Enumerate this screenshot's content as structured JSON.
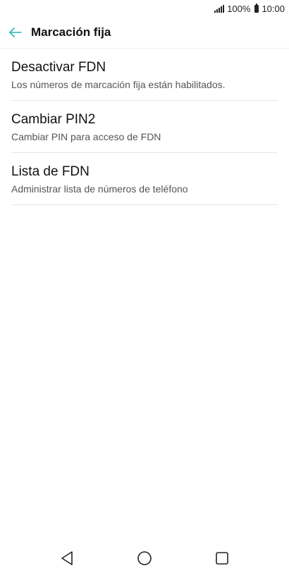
{
  "status_bar": {
    "battery_percent": "100%",
    "time": "10:00",
    "icons": [
      "signal-icon",
      "battery-icon"
    ]
  },
  "app_bar": {
    "title": "Marcación fija",
    "back_icon": "arrow-left-icon",
    "accent_color": "#2ab5b5"
  },
  "items": [
    {
      "title": "Desactivar FDN",
      "subtitle": "Los números de marcación fija están habilitados."
    },
    {
      "title": "Cambiar PIN2",
      "subtitle": "Cambiar PIN para acceso de FDN"
    },
    {
      "title": "Lista de FDN",
      "subtitle": "Administrar lista de números de teléfono"
    }
  ],
  "nav_bar": {
    "icons": [
      "back-triangle-icon",
      "home-circle-icon",
      "recents-square-icon"
    ]
  }
}
